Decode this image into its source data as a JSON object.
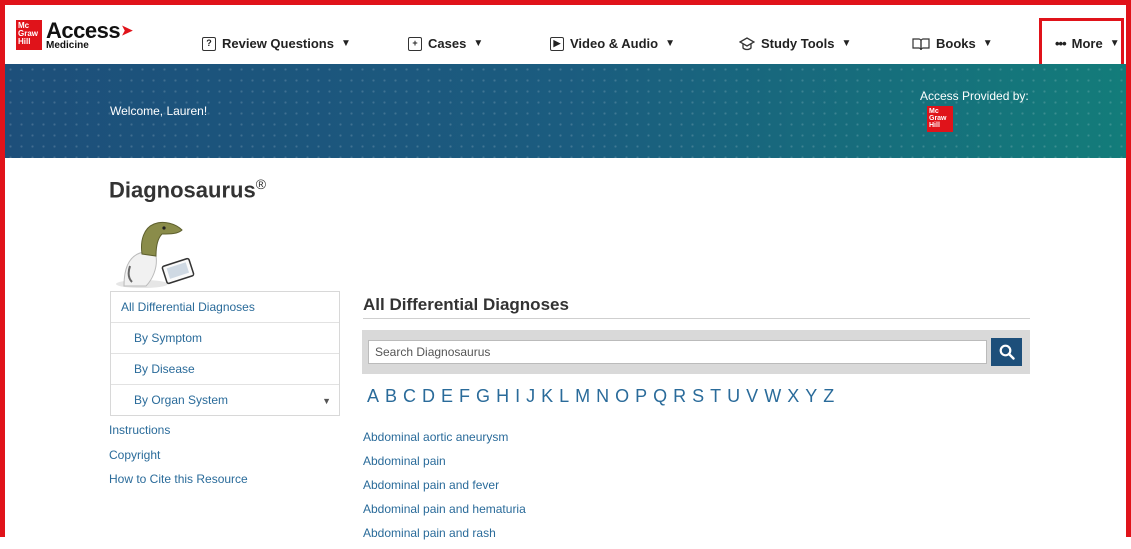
{
  "brand": {
    "publisher_logo": "Mc Graw Hill",
    "name": "Access",
    "sub": "Medicine"
  },
  "nav": {
    "items": [
      {
        "label": "Review Questions",
        "icon": "question-icon"
      },
      {
        "label": "Cases",
        "icon": "plus-box-icon"
      },
      {
        "label": "Video & Audio",
        "icon": "play-icon"
      },
      {
        "label": "Study Tools",
        "icon": "graduation-cap-icon"
      },
      {
        "label": "Books",
        "icon": "book-icon"
      }
    ],
    "more_label": "More",
    "highlight_color": "#e0131a"
  },
  "banner": {
    "welcome": "Welcome, Lauren!",
    "provided_by": "Access Provided by:"
  },
  "page": {
    "title": "Diagnosaurus",
    "title_mark": "®"
  },
  "sidebar": {
    "items": [
      {
        "label": "All Differential Diagnoses"
      },
      {
        "label": "By Symptom"
      },
      {
        "label": "By Disease"
      },
      {
        "label": "By Organ System"
      }
    ],
    "links": [
      "Instructions",
      "Copyright",
      "How to Cite this Resource"
    ]
  },
  "main": {
    "heading": "All Differential Diagnoses",
    "search_placeholder": "Search Diagnosaurus",
    "alphabet": [
      "A",
      "B",
      "C",
      "D",
      "E",
      "F",
      "G",
      "H",
      "I",
      "J",
      "K",
      "L",
      "M",
      "N",
      "O",
      "P",
      "Q",
      "R",
      "S",
      "T",
      "U",
      "V",
      "W",
      "X",
      "Y",
      "Z"
    ],
    "results": [
      "Abdominal aortic aneurysm",
      "Abdominal pain",
      "Abdominal pain and fever",
      "Abdominal pain and hematuria",
      "Abdominal pain and rash"
    ]
  },
  "colors": {
    "link": "#2a6b9a",
    "brand_red": "#e0131a",
    "banner_start": "#1d4f7a",
    "banner_end": "#137c7a"
  }
}
